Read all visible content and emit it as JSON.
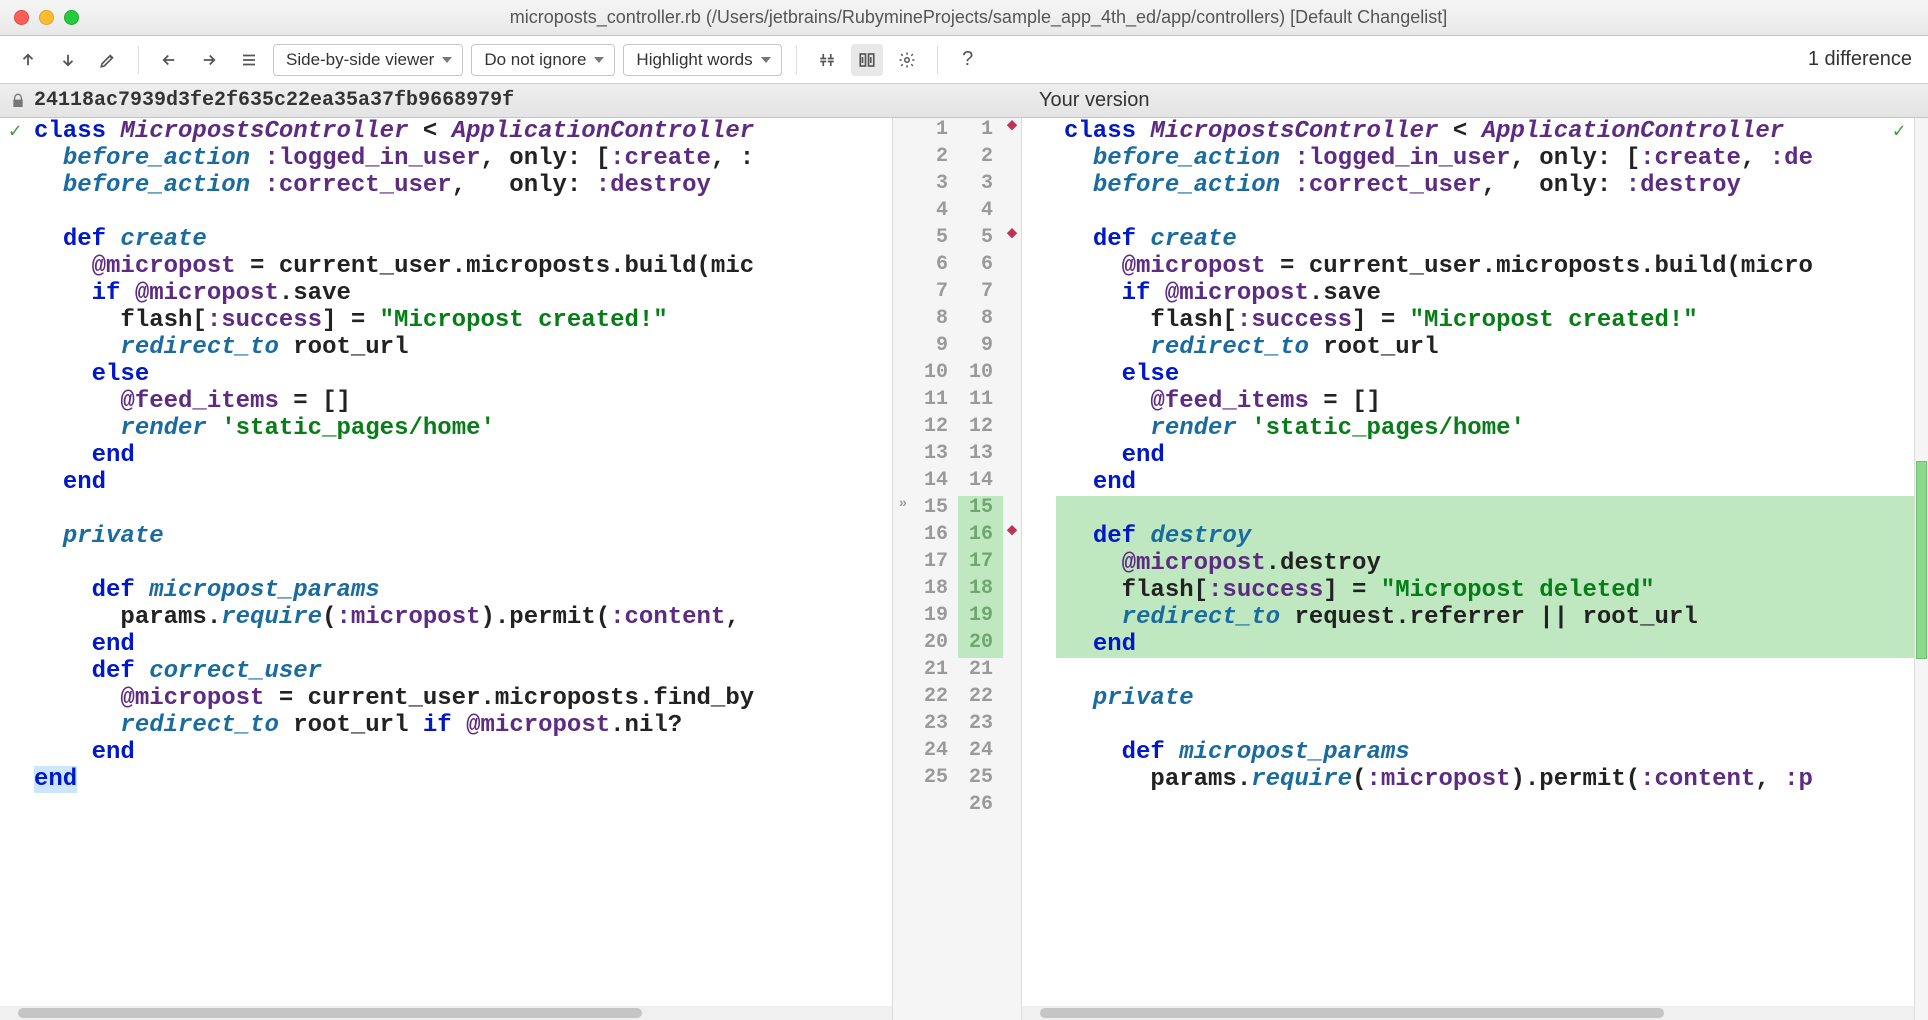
{
  "window": {
    "title": "microposts_controller.rb (/Users/jetbrains/RubymineProjects/sample_app_4th_ed/app/controllers) [Default Changelist]"
  },
  "toolbar": {
    "viewer_mode": "Side-by-side viewer",
    "ignore_mode": "Do not ignore",
    "highlight_mode": "Highlight words",
    "diff_count": "1 difference"
  },
  "labels": {
    "left_revision": "24118ac7939d3fe2f635c22ea35a37fb9668979f",
    "right_revision": "Your version"
  },
  "left_code": [
    {
      "n": 1,
      "tokens": [
        [
          "kw-class",
          "class "
        ],
        [
          "const",
          "MicropostsController"
        ],
        [
          "plain",
          " < "
        ],
        [
          "const",
          "ApplicationController"
        ]
      ]
    },
    {
      "n": 2,
      "tokens": [
        [
          "plain",
          "  "
        ],
        [
          "ident",
          "before_action"
        ],
        [
          "plain",
          " "
        ],
        [
          "sym",
          ":logged_in_user"
        ],
        [
          "plain",
          ", only: ["
        ],
        [
          "sym",
          ":create"
        ],
        [
          "plain",
          ", :"
        ]
      ]
    },
    {
      "n": 3,
      "tokens": [
        [
          "plain",
          "  "
        ],
        [
          "ident",
          "before_action"
        ],
        [
          "plain",
          " "
        ],
        [
          "sym",
          ":correct_user"
        ],
        [
          "plain",
          ",   only: "
        ],
        [
          "sym",
          ":destroy"
        ]
      ]
    },
    {
      "n": 4,
      "tokens": []
    },
    {
      "n": 5,
      "tokens": [
        [
          "plain",
          "  "
        ],
        [
          "kw",
          "def "
        ],
        [
          "ident",
          "create"
        ]
      ]
    },
    {
      "n": 6,
      "tokens": [
        [
          "plain",
          "    "
        ],
        [
          "ivar",
          "@micropost"
        ],
        [
          "plain",
          " = current_user.microposts.build(mic"
        ]
      ]
    },
    {
      "n": 7,
      "tokens": [
        [
          "plain",
          "    "
        ],
        [
          "kw",
          "if "
        ],
        [
          "ivar",
          "@micropost"
        ],
        [
          "plain",
          ".save"
        ]
      ]
    },
    {
      "n": 8,
      "tokens": [
        [
          "plain",
          "      flash["
        ],
        [
          "sym",
          ":success"
        ],
        [
          "plain",
          "] = "
        ],
        [
          "str",
          "\"Micropost created!\""
        ]
      ]
    },
    {
      "n": 9,
      "tokens": [
        [
          "plain",
          "      "
        ],
        [
          "ident",
          "redirect_to"
        ],
        [
          "plain",
          " root_url"
        ]
      ]
    },
    {
      "n": 10,
      "tokens": [
        [
          "plain",
          "    "
        ],
        [
          "kw",
          "else"
        ]
      ]
    },
    {
      "n": 11,
      "tokens": [
        [
          "plain",
          "      "
        ],
        [
          "ivar",
          "@feed_items"
        ],
        [
          "plain",
          " = []"
        ]
      ]
    },
    {
      "n": 12,
      "tokens": [
        [
          "plain",
          "      "
        ],
        [
          "ident",
          "render"
        ],
        [
          "plain",
          " "
        ],
        [
          "str",
          "'static_pages/home'"
        ]
      ]
    },
    {
      "n": 13,
      "tokens": [
        [
          "plain",
          "    "
        ],
        [
          "kw",
          "end"
        ]
      ]
    },
    {
      "n": 14,
      "tokens": [
        [
          "plain",
          "  "
        ],
        [
          "kw",
          "end"
        ]
      ]
    },
    {
      "n": 15,
      "tokens": []
    },
    {
      "n": 16,
      "tokens": [
        [
          "plain",
          "  "
        ],
        [
          "ident",
          "private"
        ]
      ]
    },
    {
      "n": 17,
      "tokens": []
    },
    {
      "n": 18,
      "tokens": [
        [
          "plain",
          "    "
        ],
        [
          "kw",
          "def "
        ],
        [
          "ident",
          "micropost_params"
        ]
      ]
    },
    {
      "n": 19,
      "tokens": [
        [
          "plain",
          "      params."
        ],
        [
          "ident",
          "require"
        ],
        [
          "plain",
          "("
        ],
        [
          "sym",
          ":micropost"
        ],
        [
          "plain",
          ").permit("
        ],
        [
          "sym",
          ":content"
        ],
        [
          "plain",
          ", "
        ]
      ]
    },
    {
      "n": 20,
      "tokens": [
        [
          "plain",
          "    "
        ],
        [
          "kw",
          "end"
        ]
      ]
    },
    {
      "n": 21,
      "tokens": [
        [
          "plain",
          "    "
        ],
        [
          "kw",
          "def "
        ],
        [
          "ident",
          "correct_user"
        ]
      ]
    },
    {
      "n": 22,
      "tokens": [
        [
          "plain",
          "      "
        ],
        [
          "ivar",
          "@micropost"
        ],
        [
          "plain",
          " = current_user.microposts.find_by"
        ]
      ]
    },
    {
      "n": 23,
      "tokens": [
        [
          "plain",
          "      "
        ],
        [
          "ident",
          "redirect_to"
        ],
        [
          "plain",
          " root_url "
        ],
        [
          "kw",
          "if "
        ],
        [
          "ivar",
          "@micropost"
        ],
        [
          "plain",
          ".nil?"
        ]
      ]
    },
    {
      "n": 24,
      "tokens": [
        [
          "plain",
          "    "
        ],
        [
          "kw",
          "end"
        ]
      ]
    },
    {
      "n": 25,
      "tokens": [
        [
          "kw",
          "end"
        ]
      ],
      "endhl": true
    }
  ],
  "right_code": [
    {
      "n": 1,
      "tokens": [
        [
          "kw-class",
          "class "
        ],
        [
          "const",
          "MicropostsController"
        ],
        [
          "plain",
          " < "
        ],
        [
          "const",
          "ApplicationController"
        ]
      ],
      "bp": true
    },
    {
      "n": 2,
      "tokens": [
        [
          "plain",
          "  "
        ],
        [
          "ident",
          "before_action"
        ],
        [
          "plain",
          " "
        ],
        [
          "sym",
          ":logged_in_user"
        ],
        [
          "plain",
          ", only: ["
        ],
        [
          "sym",
          ":create"
        ],
        [
          "plain",
          ", "
        ],
        [
          "sym",
          ":de"
        ]
      ]
    },
    {
      "n": 3,
      "tokens": [
        [
          "plain",
          "  "
        ],
        [
          "ident",
          "before_action"
        ],
        [
          "plain",
          " "
        ],
        [
          "sym",
          ":correct_user"
        ],
        [
          "plain",
          ",   only: "
        ],
        [
          "sym",
          ":destroy"
        ]
      ]
    },
    {
      "n": 4,
      "tokens": []
    },
    {
      "n": 5,
      "tokens": [
        [
          "plain",
          "  "
        ],
        [
          "kw",
          "def "
        ],
        [
          "ident",
          "create"
        ]
      ],
      "bp": true
    },
    {
      "n": 6,
      "tokens": [
        [
          "plain",
          "    "
        ],
        [
          "ivar",
          "@micropost"
        ],
        [
          "plain",
          " = current_user.microposts.build(micro"
        ]
      ]
    },
    {
      "n": 7,
      "tokens": [
        [
          "plain",
          "    "
        ],
        [
          "kw",
          "if "
        ],
        [
          "ivar",
          "@micropost"
        ],
        [
          "plain",
          ".save"
        ]
      ]
    },
    {
      "n": 8,
      "tokens": [
        [
          "plain",
          "      flash["
        ],
        [
          "sym",
          ":success"
        ],
        [
          "plain",
          "] = "
        ],
        [
          "str",
          "\"Micropost created!\""
        ]
      ]
    },
    {
      "n": 9,
      "tokens": [
        [
          "plain",
          "      "
        ],
        [
          "ident",
          "redirect_to"
        ],
        [
          "plain",
          " root_url"
        ]
      ]
    },
    {
      "n": 10,
      "tokens": [
        [
          "plain",
          "    "
        ],
        [
          "kw",
          "else"
        ]
      ]
    },
    {
      "n": 11,
      "tokens": [
        [
          "plain",
          "      "
        ],
        [
          "ivar",
          "@feed_items"
        ],
        [
          "plain",
          " = []"
        ]
      ]
    },
    {
      "n": 12,
      "tokens": [
        [
          "plain",
          "      "
        ],
        [
          "ident",
          "render"
        ],
        [
          "plain",
          " "
        ],
        [
          "str",
          "'static_pages/home'"
        ]
      ]
    },
    {
      "n": 13,
      "tokens": [
        [
          "plain",
          "    "
        ],
        [
          "kw",
          "end"
        ]
      ]
    },
    {
      "n": 14,
      "tokens": [
        [
          "plain",
          "  "
        ],
        [
          "kw",
          "end"
        ]
      ]
    },
    {
      "n": 15,
      "tokens": [],
      "green": true
    },
    {
      "n": 16,
      "tokens": [
        [
          "plain",
          "  "
        ],
        [
          "kw",
          "def "
        ],
        [
          "ident",
          "destroy"
        ]
      ],
      "green": true,
      "bp": true
    },
    {
      "n": 17,
      "tokens": [
        [
          "plain",
          "    "
        ],
        [
          "ivar",
          "@micropost"
        ],
        [
          "plain",
          ".destroy"
        ]
      ],
      "green": true
    },
    {
      "n": 18,
      "tokens": [
        [
          "plain",
          "    flash["
        ],
        [
          "sym",
          ":success"
        ],
        [
          "plain",
          "] = "
        ],
        [
          "str",
          "\"Micropost deleted\""
        ]
      ],
      "green": true
    },
    {
      "n": 19,
      "tokens": [
        [
          "plain",
          "    "
        ],
        [
          "ident",
          "redirect_to"
        ],
        [
          "plain",
          " request.referrer || root_url"
        ]
      ],
      "green": true
    },
    {
      "n": 20,
      "tokens": [
        [
          "plain",
          "  "
        ],
        [
          "kw",
          "end"
        ]
      ],
      "green": true
    },
    {
      "n": 21,
      "tokens": []
    },
    {
      "n": 22,
      "tokens": [
        [
          "plain",
          "  "
        ],
        [
          "ident",
          "private"
        ]
      ]
    },
    {
      "n": 23,
      "tokens": []
    },
    {
      "n": 24,
      "tokens": [
        [
          "plain",
          "    "
        ],
        [
          "kw",
          "def "
        ],
        [
          "ident",
          "micropost_params"
        ]
      ]
    },
    {
      "n": 25,
      "tokens": [
        [
          "plain",
          "      params."
        ],
        [
          "ident",
          "require"
        ],
        [
          "plain",
          "("
        ],
        [
          "sym",
          ":micropost"
        ],
        [
          "plain",
          ").permit("
        ],
        [
          "sym",
          ":content"
        ],
        [
          "plain",
          ", "
        ],
        [
          "sym",
          ":p"
        ]
      ]
    },
    {
      "n": 26,
      "tokens": []
    }
  ],
  "gutter": {
    "rows": 26,
    "insert_chevron_at": 15,
    "green_right_rows": [
      15,
      16,
      17,
      18,
      19,
      20
    ]
  },
  "markers": [
    {
      "top_pct": 38,
      "height_pct": 22
    }
  ]
}
